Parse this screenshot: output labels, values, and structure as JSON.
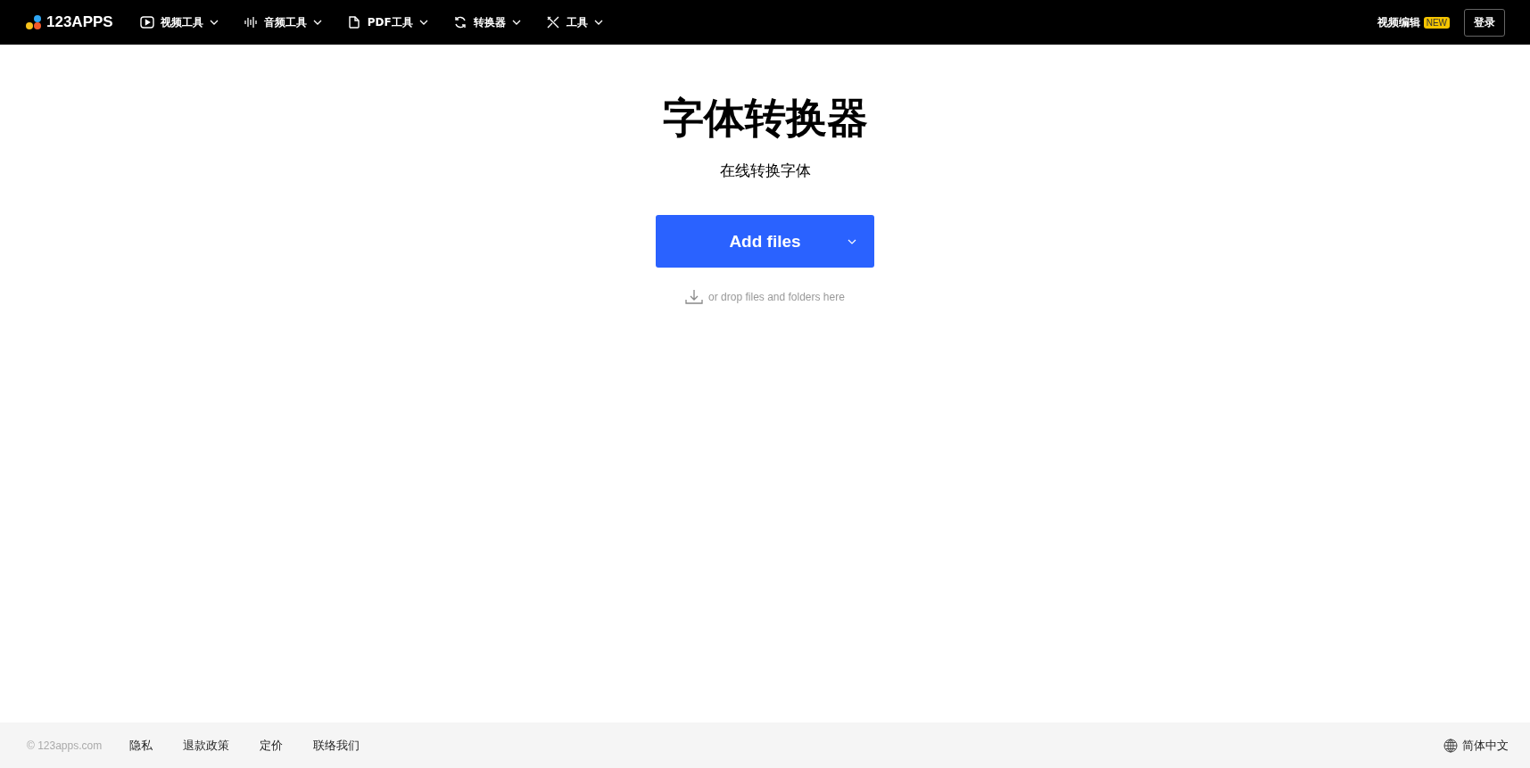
{
  "header": {
    "logo": "123APPS",
    "nav": [
      {
        "label": "视频工具",
        "kind": "video"
      },
      {
        "label": "音频工具",
        "kind": "audio"
      },
      {
        "label": "PDF工具",
        "kind": "pdf"
      },
      {
        "label": "转换器",
        "kind": "convert"
      },
      {
        "label": "工具",
        "kind": "tools"
      }
    ],
    "video_editor": "视频编辑",
    "badge": "NEW",
    "login": "登录"
  },
  "main": {
    "title": "字体转换器",
    "subtitle": "在线转换字体",
    "add_button": "Add files",
    "drop_hint": "or drop files and folders here"
  },
  "footer": {
    "copyright": "© 123apps.com",
    "links": [
      "隐私",
      "退款政策",
      "定价",
      "联络我们"
    ],
    "language": "简体中文"
  }
}
